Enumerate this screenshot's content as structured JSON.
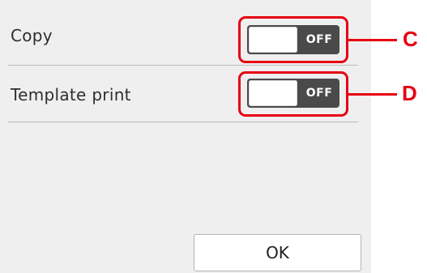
{
  "settings": {
    "rows": [
      {
        "label": "Copy",
        "toggle_state": "OFF",
        "callout": "C"
      },
      {
        "label": "Template print",
        "toggle_state": "OFF",
        "callout": "D"
      }
    ]
  },
  "footer": {
    "ok_label": "OK"
  },
  "colors": {
    "callout": "#e60012",
    "screen_background": "#efefef",
    "toggle_background": "#4a4a4a"
  }
}
